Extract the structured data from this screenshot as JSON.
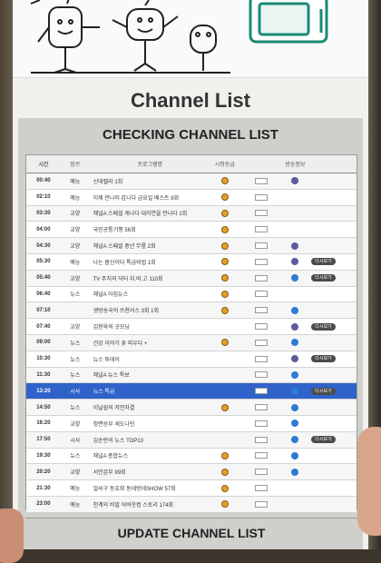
{
  "title": "Channel List",
  "checking_label": "CHECKING CHANNEL LIST",
  "update_label": "UPDATE CHANNEL LIST",
  "table": {
    "headers": [
      "시간",
      "장르",
      "프로그램명",
      "시청등급",
      "",
      "방송정보",
      ""
    ],
    "rows": [
      {
        "time": "00:40",
        "genre": "예능",
        "program": "신데렐라 1회",
        "age": true,
        "box": true,
        "dot": "purple",
        "pill": ""
      },
      {
        "time": "02:10",
        "genre": "예능",
        "program": "이제 만나러 갑니다 금요일 베스트 8회",
        "age": true,
        "box": true,
        "dot": "",
        "pill": ""
      },
      {
        "time": "03:30",
        "genre": "교양",
        "program": "채널A 스페셜 캐나다 대자연을 만나다 1회",
        "age": true,
        "box": true,
        "dot": "",
        "pill": ""
      },
      {
        "time": "04:00",
        "genre": "교양",
        "program": "국민공통기행 56회",
        "age": true,
        "box": true,
        "dot": "",
        "pill": ""
      },
      {
        "time": "04:30",
        "genre": "교양",
        "program": "채널A 스페셜 중년 무릎 2회",
        "age": true,
        "box": true,
        "dot": "purple",
        "pill": ""
      },
      {
        "time": "05:30",
        "genre": "예능",
        "program": "나는 몸신이다 특급비법 1회",
        "age": true,
        "box": true,
        "dot": "purple",
        "pill": "다시보기"
      },
      {
        "time": "05:40",
        "genre": "교양",
        "program": "TV 주치의 닥터 지.바.고 110회",
        "age": true,
        "box": true,
        "dot": "blue",
        "pill": "다시보기"
      },
      {
        "time": "06:40",
        "genre": "뉴스",
        "program": "채널A 아침뉴스",
        "age": true,
        "box": true,
        "dot": "",
        "pill": ""
      },
      {
        "time": "07:10",
        "genre": "",
        "program": "생방송국의 쓰쳔서스 3회 1회",
        "age": true,
        "box": true,
        "dot": "blue",
        "pill": ""
      },
      {
        "time": "07:40",
        "genre": "교양",
        "program": "김현욱의 굿모닝",
        "age": false,
        "box": true,
        "dot": "purple",
        "pill": "다시보기"
      },
      {
        "time": "09:00",
        "genre": "뉴스",
        "program": "건강 이야기 꽃 피우다 +",
        "age": true,
        "box": true,
        "dot": "blue",
        "pill": ""
      },
      {
        "time": "10:30",
        "genre": "뉴스",
        "program": "뉴스 투데이",
        "age": false,
        "box": true,
        "dot": "purple",
        "pill": "다시보기"
      },
      {
        "time": "11:30",
        "genre": "뉴스",
        "program": "채널A 뉴스 특보",
        "age": false,
        "box": true,
        "dot": "blue",
        "pill": ""
      },
      {
        "time": "13:20",
        "genre": "시사",
        "program": "뉴스 특급",
        "age": false,
        "box": true,
        "dot": "blue",
        "pill": "다시보기",
        "selected": true
      },
      {
        "time": "14:50",
        "genre": "뉴스",
        "program": "이날쉽의 저전자결",
        "age": true,
        "box": true,
        "dot": "blue",
        "pill": ""
      },
      {
        "time": "16:20",
        "genre": "교양",
        "program": "정면승부 세도나인",
        "age": false,
        "box": true,
        "dot": "blue",
        "pill": ""
      },
      {
        "time": "17:50",
        "genre": "시사",
        "program": "김순란의 뉴스 TOP10",
        "age": false,
        "box": true,
        "dot": "blue",
        "pill": "다시보기"
      },
      {
        "time": "19:30",
        "genre": "뉴스",
        "program": "채널A 종합뉴스",
        "age": true,
        "box": true,
        "dot": "blue",
        "pill": ""
      },
      {
        "time": "20:20",
        "genre": "교양",
        "program": "서민갑부 99회",
        "age": true,
        "box": true,
        "dot": "blue",
        "pill": ""
      },
      {
        "time": "21:30",
        "genre": "예능",
        "program": "얼씨구 동호회 동네방네SHOW 57회",
        "age": true,
        "box": true,
        "dot": "",
        "pill": ""
      },
      {
        "time": "23:00",
        "genre": "예능",
        "program": "천계의 비밀 어바웃컴 스토리 174회",
        "age": true,
        "box": true,
        "dot": "",
        "pill": ""
      }
    ]
  },
  "colors": {
    "selected_row": "#2f63c9",
    "age_badge": "#e0a12a",
    "dot_purple": "#5b5ba0",
    "dot_blue": "#2c7bd4"
  },
  "banner": {
    "tv_label": "ch"
  }
}
